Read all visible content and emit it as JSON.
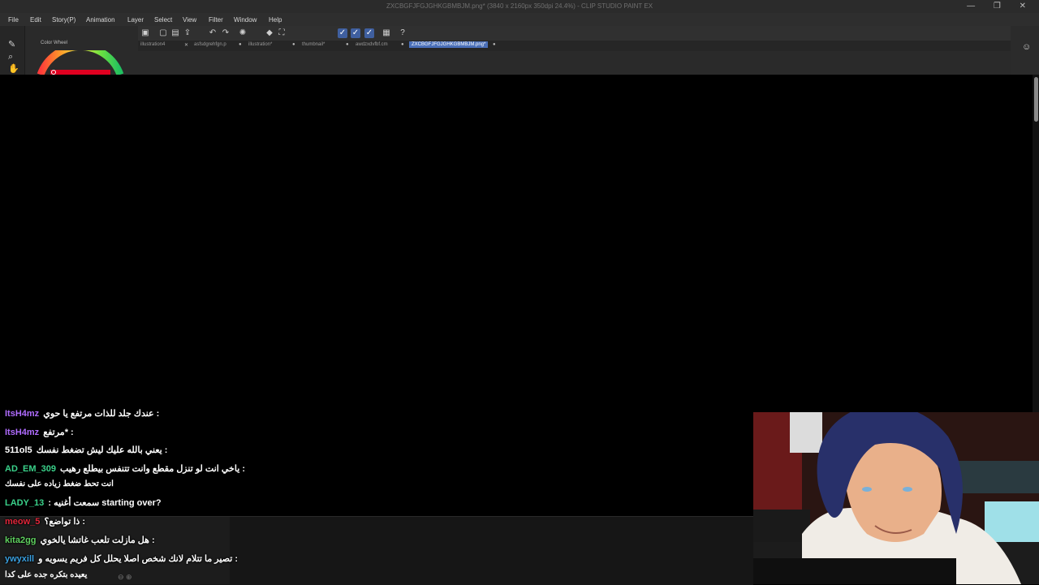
{
  "window": {
    "title": "ZXCBGFJFGJGHKGBMBJM.png* (3840 x 2160px 350dpi 24.4%)  - CLIP STUDIO PAINT EX",
    "controls": [
      "—",
      "❐",
      "✕"
    ]
  },
  "menu": [
    "File",
    "Edit",
    "Story(P)",
    "Animation",
    "Layer",
    "Select",
    "View",
    "Filter",
    "Window",
    "Help"
  ],
  "panel": {
    "color_wheel_title": "Color Wheel"
  },
  "tabs": [
    {
      "label": "illustration4",
      "close": "✕"
    },
    {
      "label": "asfsdgrehfgn.p",
      "close": "●"
    },
    {
      "label": "illustration*",
      "close": "●"
    },
    {
      "label": "thumbnail*",
      "close": "●"
    },
    {
      "label": "awdzxdvfbf.cm",
      "close": "●"
    },
    {
      "label": "ZXCBGFJFGJGHKGBMBJM.png*",
      "close": "●",
      "active": true
    }
  ],
  "chat": [
    {
      "user": "ItsH4mz",
      "color": "#b06cff",
      "message": "عندك جلد للذات مرتفع يا حوي :"
    },
    {
      "user": "ItsH4mz",
      "color": "#b06cff",
      "message": "مرتفع* :"
    },
    {
      "user": "511ol5",
      "color": "#ffffff",
      "message": "يعني بالله عليك ليش تضغط نفسك :"
    },
    {
      "user": "AD_EM_309",
      "color": "#3ad18a",
      "message": "ياخي انت لو تنزل مقطع وانت تتنفس بيطلع رهيب :"
    },
    {
      "user": "",
      "color": "#ffffff",
      "message": "انت تحط ضغط زياده على نفسك"
    },
    {
      "user": "LADY_13",
      "color": "#3ad18a",
      "message": ": سمعت أغنيه starting over?"
    },
    {
      "user": "meow_5",
      "color": "#e0263a",
      "message": "ذا تواضع؟ :"
    },
    {
      "user": "kita2gg",
      "color": "#5fd05f",
      "message": "هل مازلت تلعب غاتشا يالخوي :"
    },
    {
      "user": "ywyxill",
      "color": "#3aa0e0",
      "message": "تصير ما تتلام لانك شخص اصلا يحلل كل فريم يسويه و :"
    },
    {
      "user": "",
      "color": "#ffffff",
      "message": "يعيده بتكره جده على كدا"
    }
  ],
  "icons": {
    "toolbar": [
      "layer-icon",
      "new-icon",
      "save-icon",
      "export-icon",
      "undo-icon",
      "redo-icon",
      "settings-icon",
      "fill-icon",
      "transform-icon",
      "pen-icon",
      "pen-icon",
      "pen-icon",
      "calendar-icon",
      "help-icon"
    ],
    "tools": [
      "brush-icon",
      "zoom-icon",
      "hand-icon"
    ],
    "right": [
      "user-icon"
    ]
  }
}
